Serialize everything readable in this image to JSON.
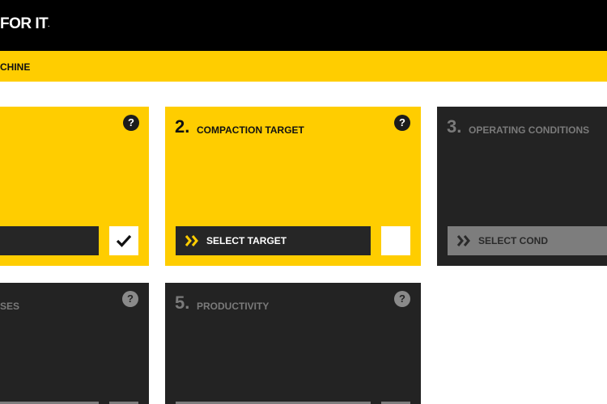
{
  "header": {
    "brand": "FOR IT",
    "brand_mark": "."
  },
  "breadcrumb": {
    "text": "CHINE"
  },
  "steps": [
    {
      "num": "",
      "label": "",
      "action": "",
      "checked": true,
      "active": true
    },
    {
      "num": "2.",
      "label": "COMPACTION TARGET",
      "action": "SELECT TARGET",
      "checked": false,
      "active": true
    },
    {
      "num": "3.",
      "label": "OPERATING CONDITIONS",
      "action": "SELECT COND",
      "checked": false,
      "active": false
    },
    {
      "num": "",
      "label": "SES",
      "action": "",
      "checked": false,
      "active": false
    },
    {
      "num": "5.",
      "label": "PRODUCTIVITY",
      "action": "",
      "checked": false,
      "active": false
    }
  ],
  "help_glyph": "?",
  "icons": {
    "help": "help-icon",
    "chevron": "double-chevron-icon",
    "check": "checkmark-icon"
  },
  "colors": {
    "accent": "#ffcd00",
    "dark_panel": "#232323",
    "header": "#000000"
  }
}
